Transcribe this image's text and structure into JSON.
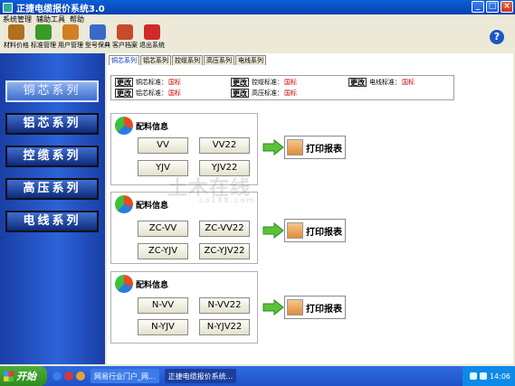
{
  "window": {
    "title": "正捷电缆报价系统3.0",
    "buttons": [
      "_",
      "□",
      "×"
    ]
  },
  "menu": [
    "系统管理",
    "辅助工具",
    "帮助"
  ],
  "toolbar": [
    {
      "label": "材料价格",
      "icon": "scissors-icon",
      "color": "#b07020"
    },
    {
      "label": "标准管理",
      "icon": "check-icon",
      "color": "#3a9a2a"
    },
    {
      "label": "用户管理",
      "icon": "users-icon",
      "color": "#d08020"
    },
    {
      "label": "型号保典",
      "icon": "magnifier-icon",
      "color": "#3a6ac8"
    },
    {
      "label": "客户档案",
      "icon": "folder-icon",
      "color": "#c84a2a"
    },
    {
      "label": "退出系统",
      "icon": "power-icon",
      "color": "#d02a2a"
    }
  ],
  "help": "?",
  "sidebar": [
    "铜芯系列",
    "铝芯系列",
    "控缆系列",
    "高压系列",
    "电线系列"
  ],
  "tabs": [
    "铜芯系列",
    "铝芯系列",
    "控缆系列",
    "高压系列",
    "电线系列"
  ],
  "standards": {
    "button": "更改",
    "rows": [
      {
        "label": "铜芯标准：",
        "value": "国标"
      },
      {
        "label": "控缆标准：",
        "value": "国标"
      },
      {
        "label": "电线标准：",
        "value": "国标"
      },
      {
        "label": "铝芯标准：",
        "value": "国标"
      },
      {
        "label": "高压标准：",
        "value": "国标"
      }
    ]
  },
  "panels": [
    {
      "title": "配料信息",
      "products": [
        "VV",
        "VV22",
        "YJV",
        "YJV22"
      ]
    },
    {
      "title": "配料信息",
      "products": [
        "ZC-VV",
        "ZC-VV22",
        "ZC-YJV",
        "ZC-YJV22"
      ]
    },
    {
      "title": "配料信息",
      "products": [
        "N-VV",
        "N-VV22",
        "N-YJV",
        "N-YJV22"
      ]
    }
  ],
  "print_label": "打印报表",
  "watermark": {
    "main": "土木在线",
    "sub": "co188.com"
  },
  "taskbar": {
    "start": "开始",
    "tasks": [
      "网易行业门户_网...",
      "正捷电缆报价系统..."
    ],
    "clock": "14:06"
  }
}
